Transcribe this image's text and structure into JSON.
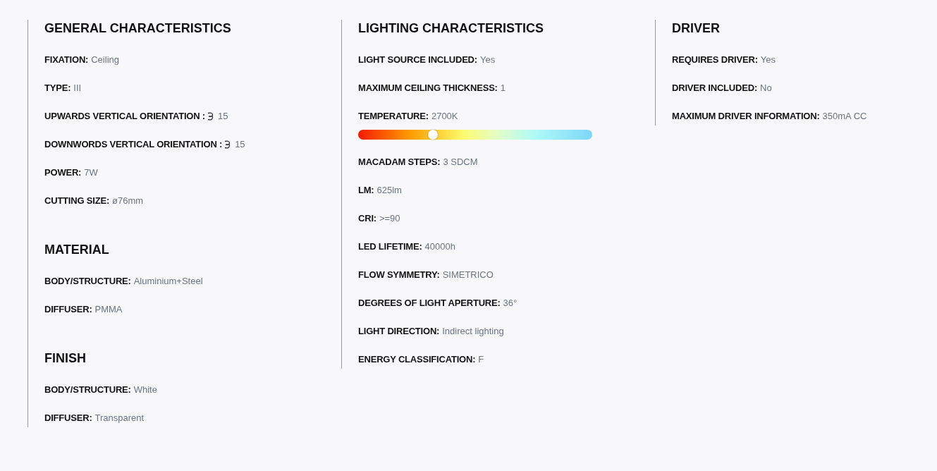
{
  "columns": [
    {
      "sections": [
        {
          "title": "GENERAL CHARACTERISTICS",
          "rows": [
            {
              "kind": "text",
              "label": "FIXATION:",
              "value": "Ceiling"
            },
            {
              "kind": "text",
              "label": "TYPE:",
              "value": "III"
            },
            {
              "kind": "angle",
              "label": "UPWARDS VERTICAL ORIENTATION :",
              "value": "15"
            },
            {
              "kind": "angle",
              "label": "DOWNWORDS VERTICAL ORIENTATION :",
              "value": "15"
            },
            {
              "kind": "text",
              "label": "POWER:",
              "value": "7W"
            },
            {
              "kind": "text",
              "label": "CUTTING SIZE:",
              "value": "ø76mm"
            }
          ]
        },
        {
          "title": "MATERIAL",
          "rows": [
            {
              "kind": "text",
              "label": "BODY/STRUCTURE:",
              "value": "Aluminium+Steel"
            },
            {
              "kind": "text",
              "label": "DIFFUSER:",
              "value": "PMMA"
            }
          ]
        },
        {
          "title": "FINISH",
          "rows": [
            {
              "kind": "text",
              "label": "BODY/STRUCTURE:",
              "value": "White"
            },
            {
              "kind": "text",
              "label": "DIFFUSER:",
              "value": "Transparent"
            }
          ]
        }
      ]
    },
    {
      "sections": [
        {
          "title": "LIGHTING CHARACTERISTICS",
          "rows": [
            {
              "kind": "text",
              "label": "LIGHT SOURCE INCLUDED:",
              "value": "Yes"
            },
            {
              "kind": "text",
              "label": "MAXIMUM CEILING THICKNESS:",
              "value": "1"
            },
            {
              "kind": "slider",
              "label": "TEMPERATURE:",
              "value": "2700K",
              "level": 0.32
            },
            {
              "kind": "text",
              "label": "MACADAM STEPS:",
              "value": "3 SDCM"
            },
            {
              "kind": "text",
              "label": "LM:",
              "value": "625lm"
            },
            {
              "kind": "text",
              "label": "CRI:",
              "value": ">=90"
            },
            {
              "kind": "text",
              "label": "LED LIFETIME:",
              "value": "40000h"
            },
            {
              "kind": "text",
              "label": "FLOW SYMMETRY:",
              "value": "SIMETRICO"
            },
            {
              "kind": "text",
              "label": "DEGREES OF LIGHT APERTURE:",
              "value": "36°"
            },
            {
              "kind": "text",
              "label": "LIGHT DIRECTION:",
              "value": "Indirect lighting"
            },
            {
              "kind": "text",
              "label": "ENERGY CLASSIFICATION:",
              "value": "F"
            }
          ]
        }
      ]
    },
    {
      "sections": [
        {
          "title": "DRIVER",
          "rows": [
            {
              "kind": "text",
              "label": "REQUIRES DRIVER:",
              "value": "Yes"
            },
            {
              "kind": "text",
              "label": "DRIVER INCLUDED:",
              "value": "No"
            },
            {
              "kind": "text",
              "label": "MAXIMUM DRIVER INFORMATION:",
              "value": "350mA CC"
            }
          ]
        }
      ]
    }
  ]
}
